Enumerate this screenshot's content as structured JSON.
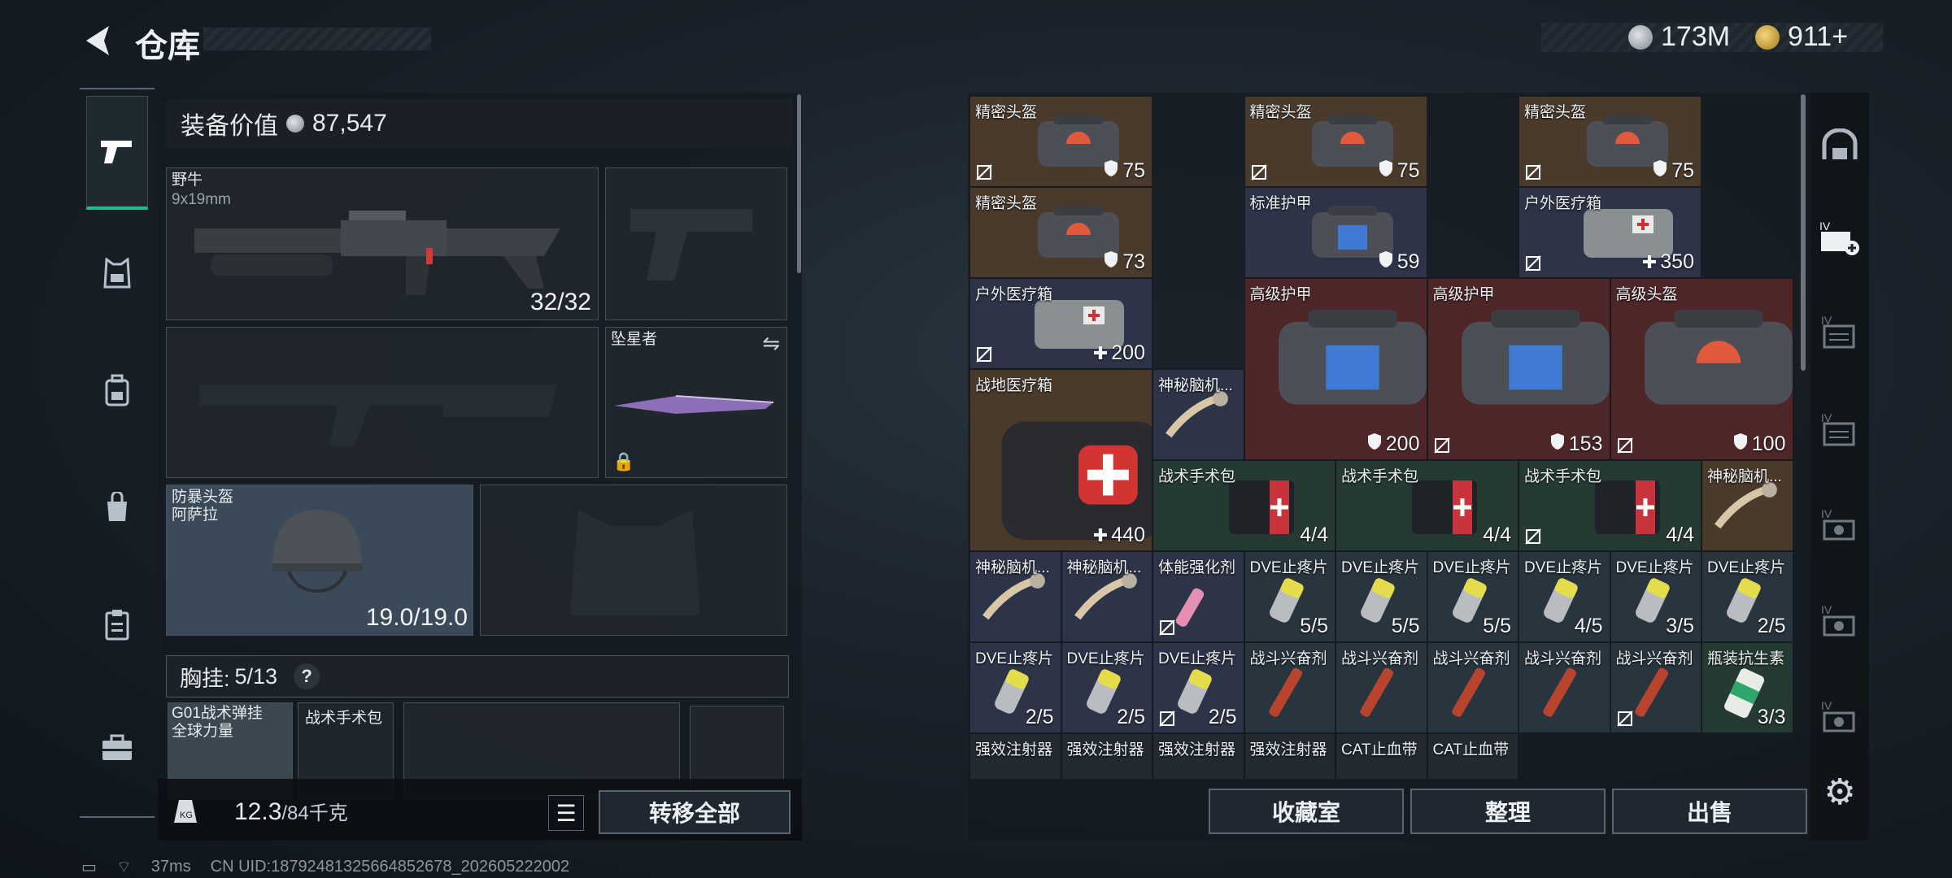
{
  "header": {
    "back_icon": "chevron-left-icon",
    "title": "仓库"
  },
  "currency": {
    "silver": "173M",
    "gold": "911+"
  },
  "nav": {
    "items": [
      "pistol-icon",
      "armor-icon",
      "backpack-icon",
      "bag-icon",
      "clipboard-icon",
      "toolbox-icon"
    ]
  },
  "equipment": {
    "value_label": "装备价值",
    "value": "87,547",
    "primary": {
      "name": "野牛",
      "caliber": "9x19mm",
      "ammo": "32/32"
    },
    "melee": {
      "name": "坠星者"
    },
    "helmet": {
      "name": "防暴头盔",
      "sub": "阿萨拉",
      "durability": "19.0/19.0"
    },
    "chest": {
      "label": "胸挂:",
      "count": "5/13",
      "help": "?"
    },
    "chest_items": [
      {
        "name": "G01战术弹挂",
        "sub": "全球力量"
      },
      {
        "name": "战术手术包"
      }
    ],
    "weight": "12.3",
    "weight_max": "/84千克",
    "transfer_all": "转移全部"
  },
  "grid": {
    "items": [
      {
        "name": "精密头盔",
        "count": "75",
        "icon": "shield"
      },
      {
        "name": "精密头盔",
        "count": "75",
        "icon": "shield"
      },
      {
        "name": "精密头盔",
        "count": "75",
        "icon": "shield"
      },
      {
        "name": "精密头盔",
        "count": "73",
        "icon": "shield"
      },
      {
        "name": "标准护甲",
        "count": "59",
        "icon": "shield"
      },
      {
        "name": "户外医疗箱",
        "count": "350",
        "icon": "plus"
      },
      {
        "name": "户外医疗箱",
        "count": "200",
        "icon": "plus"
      },
      {
        "name": "高级护甲",
        "count": "200",
        "icon": "shield"
      },
      {
        "name": "高级护甲",
        "count": "153",
        "icon": "shield"
      },
      {
        "name": "高级头盔",
        "count": "100",
        "icon": "shield"
      },
      {
        "name": "战地医疗箱",
        "count": "440",
        "icon": "plus"
      },
      {
        "name": "神秘脑机...",
        "count": ""
      },
      {
        "name": "战术手术包",
        "count": "4/4"
      },
      {
        "name": "战术手术包",
        "count": "4/4"
      },
      {
        "name": "战术手术包",
        "count": "4/4"
      },
      {
        "name": "神秘脑机...",
        "count": ""
      },
      {
        "name": "神秘脑机...",
        "count": ""
      },
      {
        "name": "神秘脑机...",
        "count": ""
      },
      {
        "name": "体能强化剂",
        "count": ""
      },
      {
        "name": "DVE止疼片",
        "count": "5/5"
      },
      {
        "name": "DVE止疼片",
        "count": "5/5"
      },
      {
        "name": "DVE止疼片",
        "count": "5/5"
      },
      {
        "name": "DVE止疼片",
        "count": "4/5"
      },
      {
        "name": "DVE止疼片",
        "count": "3/5"
      },
      {
        "name": "DVE止疼片",
        "count": "2/5"
      },
      {
        "name": "DVE止疼片",
        "count": "2/5"
      },
      {
        "name": "DVE止疼片",
        "count": "2/5"
      },
      {
        "name": "DVE止疼片",
        "count": "2/5"
      },
      {
        "name": "战斗兴奋剂",
        "count": ""
      },
      {
        "name": "战斗兴奋剂",
        "count": ""
      },
      {
        "name": "战斗兴奋剂",
        "count": ""
      },
      {
        "name": "战斗兴奋剂",
        "count": ""
      },
      {
        "name": "战斗兴奋剂",
        "count": ""
      },
      {
        "name": "瓶装抗生素",
        "count": "3/3"
      },
      {
        "name": "强效注射器",
        "count": ""
      },
      {
        "name": "强效注射器",
        "count": ""
      },
      {
        "name": "强效注射器",
        "count": ""
      },
      {
        "name": "强效注射器",
        "count": ""
      },
      {
        "name": "CAT止血带",
        "count": ""
      },
      {
        "name": "CAT止血带",
        "count": ""
      }
    ]
  },
  "actions": {
    "collection": "收藏室",
    "sort": "整理",
    "sell": "出售"
  },
  "status": {
    "ping": "37ms",
    "uid": "CN UID:18792481325664852678_202605222002"
  }
}
